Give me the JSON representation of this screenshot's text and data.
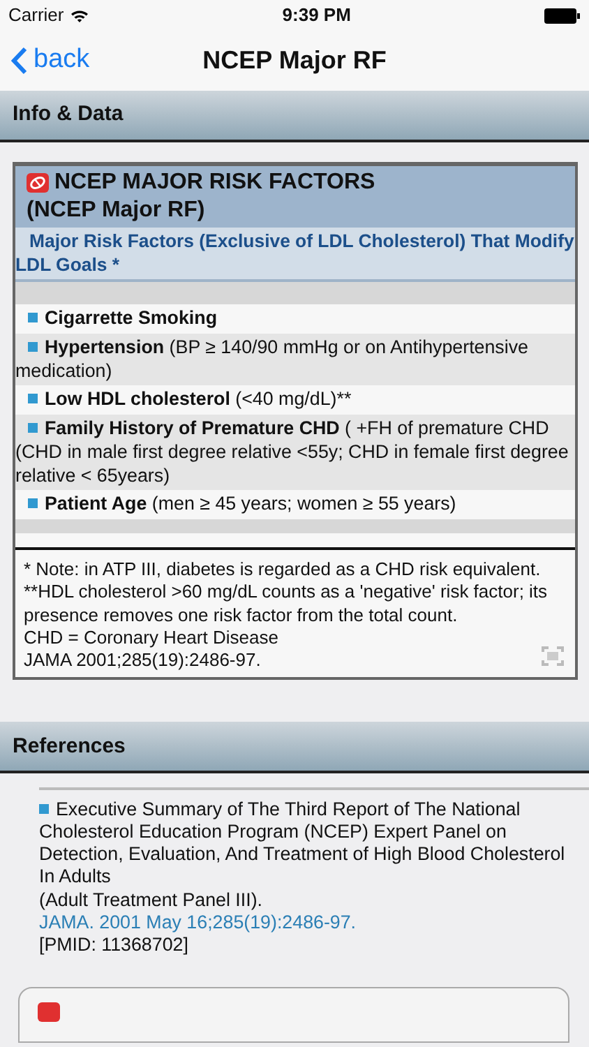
{
  "status_bar": {
    "carrier": "Carrier",
    "time": "9:39 PM"
  },
  "nav": {
    "back": "back",
    "title": "NCEP Major RF"
  },
  "info_section": {
    "title": "Info & Data",
    "card": {
      "title": "NCEP MAJOR RISK FACTORS",
      "subtitle": "(NCEP Major RF)",
      "heading": "Major Risk Factors (Exclusive of LDL Cholesterol) That Modify LDL Goals *",
      "factors": [
        {
          "name": "Cigarrette Smoking"
        },
        {
          "name": "Hypertension",
          "detail": " (BP ≥ 140/90 mmHg or on Antihypertensive medication)"
        },
        {
          "name": "Low HDL cholesterol",
          "detail": " (<40 mg/dL)**"
        },
        {
          "name": "Family History of Premature CHD",
          "detail": " ( +FH of premature CHD (CHD in male first degree relative <55y; CHD in female first degree relative < 65years)"
        },
        {
          "name": "Patient Age",
          "detail": " (men ≥ 45 years; women ≥ 55 years)"
        }
      ],
      "notes": [
        "* Note: in ATP III, diabetes is regarded as a CHD risk equivalent.",
        "**HDL cholesterol >60 mg/dL counts as a 'negative' risk factor; its presence removes one risk factor from the total count.",
        "CHD = Coronary Heart Disease",
        "JAMA 2001;285(19):2486-97."
      ]
    }
  },
  "references_section": {
    "title": "References",
    "reference": {
      "text": "Executive Summary of The Third Report of The National Cholesterol Education Program (NCEP) Expert Panel on Detection, Evaluation, And Treatment of High Blood Cholesterol In Adults",
      "panel": "(Adult Treatment Panel III).",
      "link": "JAMA. 2001 May 16;285(19):2486-97.",
      "pmid": "[PMID: 11368702]"
    }
  }
}
